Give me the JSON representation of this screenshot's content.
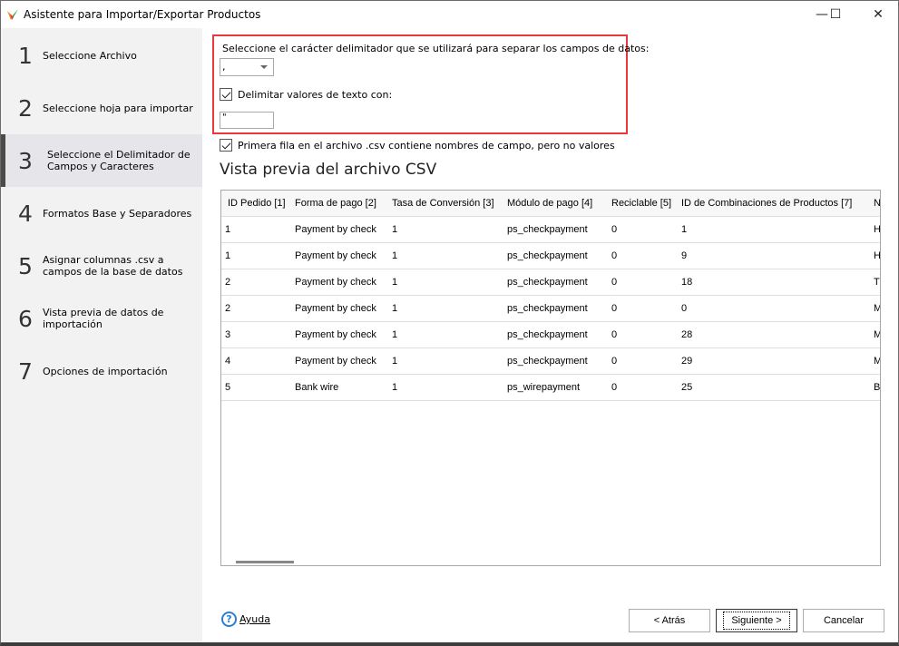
{
  "window": {
    "title": "Asistente para Importar/Exportar Productos",
    "minimize": "—",
    "maximize": "☐",
    "close": "✕"
  },
  "sidebar": {
    "active_step": 3,
    "steps": [
      {
        "num": "1",
        "label": "Seleccione Archivo"
      },
      {
        "num": "2",
        "label": "Seleccione hoja para importar"
      },
      {
        "num": "3",
        "label": "Seleccione el Delimitador de Campos y Caracteres"
      },
      {
        "num": "4",
        "label": "Formatos Base y Separadores"
      },
      {
        "num": "5",
        "label": "Asignar columnas .csv a campos de la base de datos"
      },
      {
        "num": "6",
        "label": "Vista previa de datos de importación"
      },
      {
        "num": "7",
        "label": "Opciones de importación"
      }
    ]
  },
  "delimiter": {
    "label": "Seleccione el carácter delimitador que se utilizará para separar los campos de datos:",
    "value": ","
  },
  "text_qualifier": {
    "checked": true,
    "label": "Delimitar valores de texto con:",
    "value": "\""
  },
  "first_row": {
    "checked": true,
    "label": "Primera fila en el archivo .csv contiene nombres de campo, pero no valores"
  },
  "preview": {
    "title": "Vista previa del archivo CSV",
    "columns": [
      "ID Pedido [1]",
      "Forma de pago [2]",
      "Tasa de Conversión [3]",
      "Módulo de pago [4]",
      "Reciclable [5]",
      "ID de Combinaciones de Productos [7]",
      "N"
    ],
    "rows": [
      [
        "1",
        "Payment by check",
        "1",
        "ps_checkpayment",
        "0",
        "1",
        "Hu"
      ],
      [
        "1",
        "Payment by check",
        "1",
        "ps_checkpayment",
        "0",
        "9",
        "Hu"
      ],
      [
        "2",
        "Payment by check",
        "1",
        "ps_checkpayment",
        "0",
        "18",
        "Th"
      ],
      [
        "2",
        "Payment by check",
        "1",
        "ps_checkpayment",
        "0",
        "0",
        "M"
      ],
      [
        "3",
        "Payment by check",
        "1",
        "ps_checkpayment",
        "0",
        "28",
        "M"
      ],
      [
        "4",
        "Payment by check",
        "1",
        "ps_checkpayment",
        "0",
        "29",
        "M"
      ],
      [
        "5",
        "Bank wire",
        "1",
        "ps_wirepayment",
        "0",
        "25",
        "Br"
      ]
    ]
  },
  "footer": {
    "help": "Ayuda",
    "back": "< Atrás",
    "next": "Siguiente >",
    "cancel": "Cancelar"
  },
  "colors": {
    "highlight": "#e8383d",
    "help": "#2a7fd4"
  }
}
